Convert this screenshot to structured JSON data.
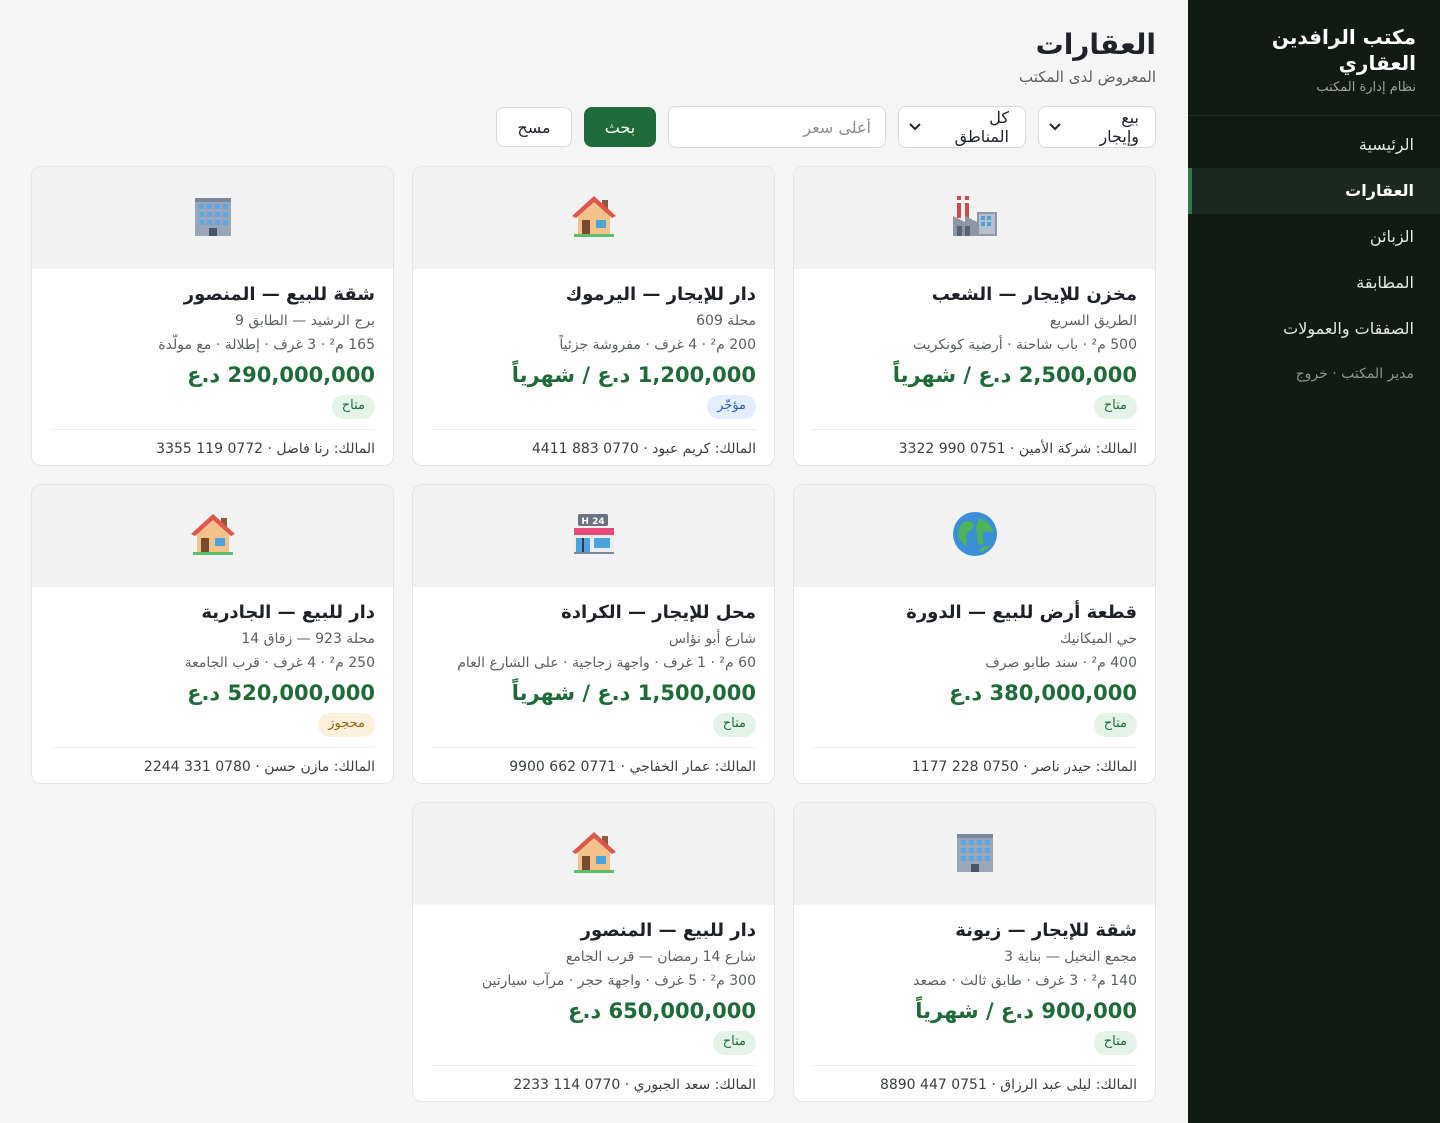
{
  "sidebar": {
    "brand_title": "مكتب الرافدين العقاري",
    "brand_sub": "نظام إدارة المكتب",
    "items": [
      {
        "label": "الرئيسية"
      },
      {
        "label": "العقارات"
      },
      {
        "label": "الزبائن"
      },
      {
        "label": "المطابقة"
      },
      {
        "label": "الصفقات والعمولات"
      }
    ],
    "footer_user": "مدير المكتب",
    "footer_sep": " · ",
    "footer_logout": "خروج"
  },
  "header": {
    "title": "العقارات",
    "subtitle": "المعروض لدى المكتب"
  },
  "filters": {
    "type_selected": "بيع وإيجار",
    "area_selected": "كل المناطق",
    "price_placeholder": "أعلى سعر",
    "search_label": "بحث",
    "clear_label": "مسح"
  },
  "properties": [
    {
      "icon": "factory-icon",
      "title": "مخزن للإيجار — الشعب",
      "location": "الطريق السريع",
      "details": "500 م² · باب شاحنة · أرضية كونكريت",
      "price": "2,500,000 د.ع / شهرياً",
      "status": "متاح",
      "owner": "المالك: شركة الأمين · 0751 990 3322"
    },
    {
      "icon": "house-icon",
      "title": "دار للإيجار — اليرموك",
      "location": "محلة 609",
      "details": "200 م² · 4 غرف · مفروشة جزئياً",
      "price": "1,200,000 د.ع / شهرياً",
      "status": "مؤجّر",
      "owner": "المالك: كريم عبود · 0770 883 4411"
    },
    {
      "icon": "office-building-icon",
      "title": "شقة للبيع — المنصور",
      "location": "برج الرشيد — الطابق 9",
      "details": "165 م² · 3 غرف · إطلالة · مع مولّدة",
      "price": "290,000,000 د.ع",
      "status": "متاح",
      "owner": "المالك: رنا فاضل · 0772 119 3355"
    },
    {
      "icon": "globe-icon",
      "title": "قطعة أرض للبيع — الدورة",
      "location": "حي الميكانيك",
      "details": "400 م² · سند طابو صرف",
      "price": "380,000,000 د.ع",
      "status": "متاح",
      "owner": "المالك: حيدر ناصر · 0750 228 1177"
    },
    {
      "icon": "shop-24h-icon",
      "title": "محل للإيجار — الكرادة",
      "location": "شارع أبو نؤاس",
      "details": "60 م² · 1 غرف · واجهة زجاجية · على الشارع العام",
      "price": "1,500,000 د.ع / شهرياً",
      "status": "متاح",
      "owner": "المالك: عمار الخفاجي · 0771 662 9900"
    },
    {
      "icon": "house-icon",
      "title": "دار للبيع — الجادرية",
      "location": "محلة 923 — زقاق 14",
      "details": "250 م² · 4 غرف · قرب الجامعة",
      "price": "520,000,000 د.ع",
      "status": "محجوز",
      "owner": "المالك: مازن حسن · 0780 331 2244"
    },
    {
      "icon": "office-building-icon",
      "title": "شقة للإيجار — زيونة",
      "location": "مجمع النخيل — بناية 3",
      "details": "140 م² · 3 غرف · طابق ثالث · مصعد",
      "price": "900,000 د.ع / شهرياً",
      "status": "متاح",
      "owner": "المالك: ليلى عبد الرزاق · 0751 447 8890"
    },
    {
      "icon": "house-icon",
      "title": "دار للبيع — المنصور",
      "location": "شارع 14 رمضان — قرب الجامع",
      "details": "300 م² · 5 غرف · واجهة حجر · مرآب سيارتين",
      "price": "650,000,000 د.ع",
      "status": "متاح",
      "owner": "المالك: سعد الجبوري · 0770 114 2233"
    }
  ]
}
